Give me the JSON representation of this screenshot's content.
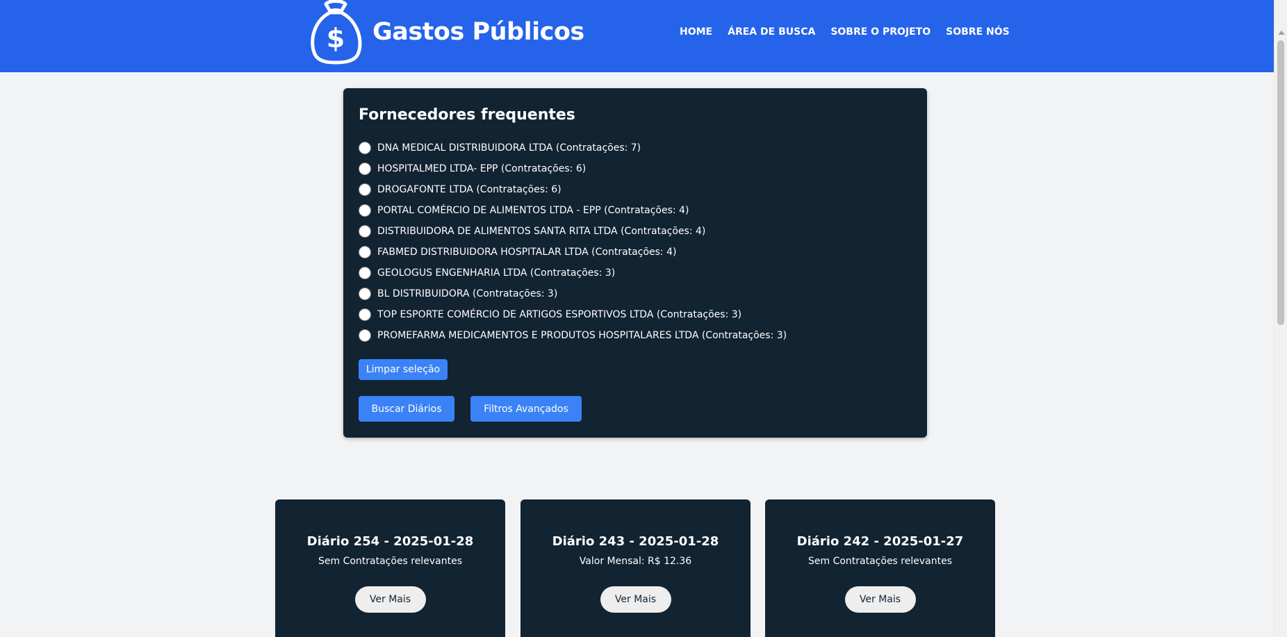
{
  "header": {
    "brand": "Gastos Públicos",
    "logo_icon": "money-bag-icon",
    "nav": [
      "HOME",
      "ÁREA DE BUSCA",
      "SOBRE O PROJETO",
      "SOBRE NÓS"
    ]
  },
  "filter_panel": {
    "title": "Fornecedores frequentes",
    "suppliers": [
      "DNA MEDICAL DISTRIBUIDORA LTDA (Contratações: 7)",
      "HOSPITALMED LTDA- EPP (Contratações: 6)",
      "DROGAFONTE LTDA (Contratações: 6)",
      "PORTAL COMÉRCIO DE ALIMENTOS LTDA - EPP (Contratações: 4)",
      "DISTRIBUIDORA DE ALIMENTOS SANTA RITA LTDA (Contratações: 4)",
      "FABMED DISTRIBUIDORA HOSPITALAR LTDA (Contratações: 4)",
      "GEOLOGUS ENGENHARIA LTDA (Contratações: 3)",
      "BL DISTRIBUIDORA (Contratações: 3)",
      "TOP ESPORTE COMÉRCIO DE ARTIGOS ESPORTIVOS LTDA (Contratações: 3)",
      "PROMEFARMA MEDICAMENTOS E PRODUTOS HOSPITALARES LTDA (Contratações: 3)"
    ],
    "clear_label": "Limpar seleção",
    "search_label": "Buscar Diários",
    "advanced_label": "Filtros Avançados"
  },
  "cards": [
    {
      "title": "Diário 254 - 2025-01-28",
      "subtitle": "Sem Contratações relevantes",
      "button": "Ver Mais"
    },
    {
      "title": "Diário 243 - 2025-01-28",
      "subtitle": "Valor Mensal: R$ 12.36",
      "button": "Ver Mais"
    },
    {
      "title": "Diário 242 - 2025-01-27",
      "subtitle": "Sem Contratações relevantes",
      "button": "Ver Mais"
    }
  ],
  "colors": {
    "header": "#2563eb",
    "panel": "#122332",
    "button": "#3b82f6",
    "background": "#f2f3f5"
  }
}
